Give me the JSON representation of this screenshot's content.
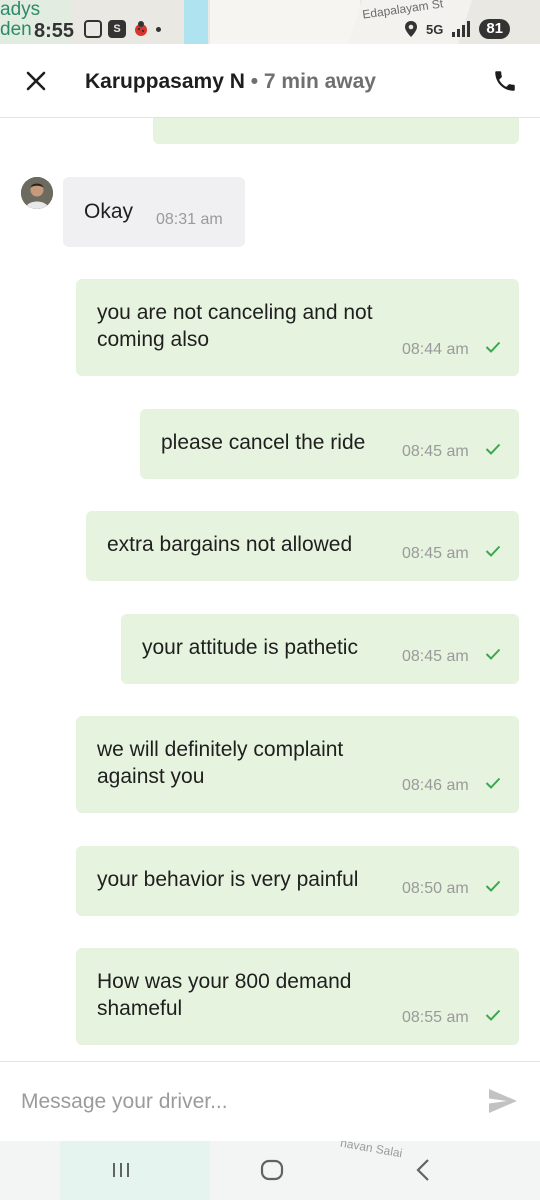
{
  "status_bar": {
    "map_label_1": "adys",
    "map_label_2": "den",
    "time": "8:55",
    "street_label": "Edapalayam St",
    "network": "5G",
    "battery": "81"
  },
  "header": {
    "driver_name": "Karuppasamy N",
    "separator": " • ",
    "eta": "7 min away"
  },
  "messages": [
    {
      "direction": "incoming",
      "text": "Okay",
      "time": "08:31 am"
    },
    {
      "direction": "outgoing",
      "text": "you are not canceling and not coming also",
      "time": "08:44 am"
    },
    {
      "direction": "outgoing",
      "text": "please cancel the ride",
      "time": "08:45 am"
    },
    {
      "direction": "outgoing",
      "text": "extra bargains not allowed",
      "time": "08:45 am"
    },
    {
      "direction": "outgoing",
      "text": "your attitude is pathetic",
      "time": "08:45 am"
    },
    {
      "direction": "outgoing",
      "text": "we will definitely complaint against you",
      "time": "08:46 am"
    },
    {
      "direction": "outgoing",
      "text": "your behavior is very painful",
      "time": "08:50 am"
    },
    {
      "direction": "outgoing",
      "text": "How was your 800 demand shameful",
      "time": "08:55 am"
    }
  ],
  "input": {
    "placeholder": "Message your driver...",
    "value": ""
  },
  "nav_bar": {
    "map_label": "navan Salai"
  },
  "icons": {
    "close": "close-icon",
    "call": "phone-icon",
    "send": "send-icon",
    "read": "check-icon",
    "recents": "recents-icon",
    "home": "home-icon",
    "back": "back-icon"
  },
  "colors": {
    "outgoing_bubble": "#e6f3df",
    "incoming_bubble": "#f0f0f2",
    "read_tick": "#3aa64d"
  }
}
